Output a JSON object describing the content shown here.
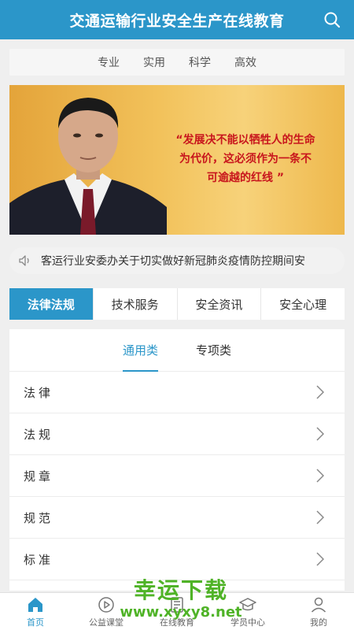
{
  "header": {
    "title": "交通运输行业安全生产在线教育",
    "search_icon": "search-icon"
  },
  "tagline": [
    "专业",
    "实用",
    "科学",
    "高效"
  ],
  "banner": {
    "quote_lines": [
      "“发展决不能以牺牲人的生命",
      "为代价，这必须作为一条不",
      "可逾越的红线 ”"
    ]
  },
  "notice": {
    "icon": "speaker-icon",
    "text": "客运行业安委办关于切实做好新冠肺炎疫情防控期间安"
  },
  "category_tabs": [
    {
      "label": "法律法规",
      "active": true
    },
    {
      "label": "技术服务",
      "active": false
    },
    {
      "label": "安全资讯",
      "active": false
    },
    {
      "label": "安全心理",
      "active": false
    }
  ],
  "sub_tabs": [
    {
      "label": "通用类",
      "active": true
    },
    {
      "label": "专项类",
      "active": false
    }
  ],
  "list_items": [
    "法律",
    "法规",
    "规章",
    "规范",
    "标准"
  ],
  "bottom_nav": [
    {
      "label": "首页",
      "icon": "home-icon",
      "active": true
    },
    {
      "label": "公益课堂",
      "icon": "play-circle-icon",
      "active": false
    },
    {
      "label": "在线教育",
      "icon": "document-icon",
      "active": false
    },
    {
      "label": "学员中心",
      "icon": "graduation-cap-icon",
      "active": false
    },
    {
      "label": "我的",
      "icon": "user-icon",
      "active": false
    }
  ],
  "watermark": {
    "cn": "幸运下载",
    "url": "www.xyxy8.net"
  },
  "colors": {
    "primary": "#2b96c9",
    "quote_red": "#c8161d",
    "watermark_green": "#4fb327"
  }
}
